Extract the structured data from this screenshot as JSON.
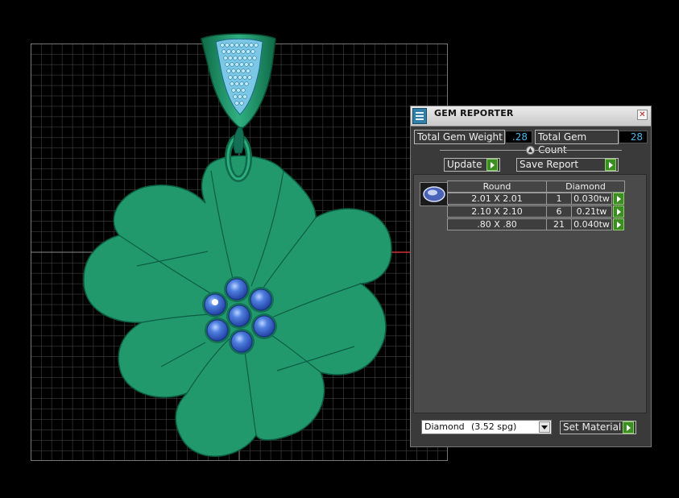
{
  "gem_reporter": {
    "title": "GEM REPORTER",
    "close_glyph": "✕",
    "total_gem_weight_label": "Total Gem Weight",
    "total_gem_weight_value": ".28",
    "total_gem_count_label": "Total Gem Count",
    "total_gem_count_value": "28",
    "update_label": "Update",
    "save_report_label": "Save Report",
    "table": {
      "shape_header": "Round",
      "material_header": "Diamond",
      "rows": [
        {
          "size": "2.01 X 2.01",
          "count": "1",
          "weight": "0.030tw"
        },
        {
          "size": "2.10 X 2.10",
          "count": "6",
          "weight": "0.21tw"
        },
        {
          "size": ".80 X .80",
          "count": "21",
          "weight": "0.040tw"
        }
      ]
    },
    "material_select": {
      "name": "Diamond",
      "spg": "(3.52 spg)"
    },
    "set_material_label": "Set Material"
  },
  "colors": {
    "metal": "#22996d",
    "metal_dark": "#137055",
    "gem_blue": "#3a64c8",
    "pave_blue": "#8fd0ee",
    "grid": "#5a5a5a",
    "axis_red": "#d03030",
    "accent_value": "#4fb6e8",
    "go_green": "#3c8e22"
  }
}
